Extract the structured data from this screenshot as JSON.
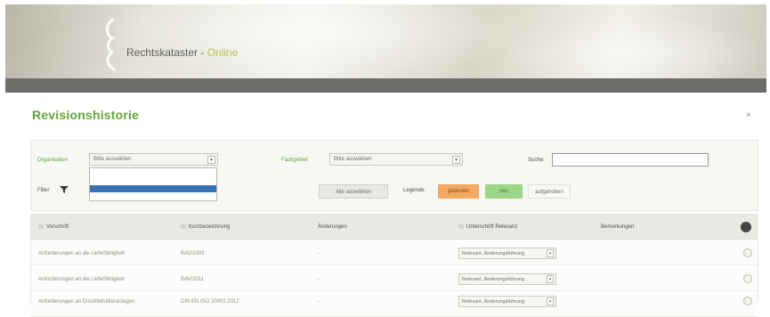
{
  "header": {
    "brand_name": "Rechtskataster",
    "brand_separator": " - ",
    "brand_suffix": "Online",
    "logo_icon": "leaf-logo-icon"
  },
  "page": {
    "title": "Revisionshistorie",
    "close_glyph": "×"
  },
  "filters": {
    "organisation_label": "Organisation",
    "organisation_value": "Bitte auswählen",
    "fachgebiet_label": "Fachgebiet",
    "fachgebiet_value": "Bitte auswählen",
    "search_label": "Suche:",
    "search_value": "",
    "filter_label": "Filter",
    "filter_icon": "funnel-icon",
    "select_all_button": "Alle auswählen",
    "legend_label": "Legende:",
    "legend_items": [
      "geändert",
      "neu",
      "aufgehoben"
    ],
    "legend_colors": [
      "#f3a964",
      "#9ed688",
      "#f7f7f4"
    ]
  },
  "table": {
    "columns": [
      "Vorschrift",
      "Kurzbezeichnung",
      "Änderungen",
      "Unterschrift Relevanz",
      "Bemerkungen"
    ],
    "rows": [
      {
        "vorschrift": "Anforderungen an die Lieferfähigkeit",
        "kurz": "BAV/2009",
        "aenderung": "-",
        "relevanz": "Relevant, Änderungsführung"
      },
      {
        "vorschrift": "Anforderungen an die Lieferfähigkeit",
        "kurz": "BAV/2011",
        "aenderung": "-",
        "relevanz": "Relevant, Änderungsführung"
      },
      {
        "vorschrift": "Anforderungen an Druckbehälteranlagen",
        "kurz": "DIN EN ISO 20001:2012",
        "aenderung": "-",
        "relevanz": "Relevant, Änderungsführung"
      }
    ]
  }
}
